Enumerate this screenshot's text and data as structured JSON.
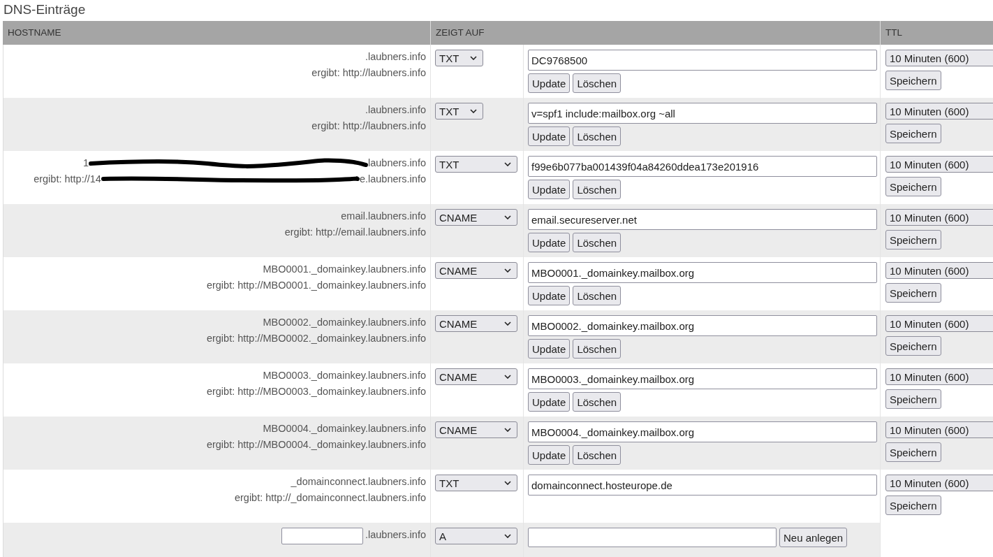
{
  "title": "DNS-Einträge",
  "columns": [
    "HOSTNAME",
    "ZEIGT AUF",
    "TTL"
  ],
  "rows": [
    {
      "kind": "record",
      "hostname": ".laubners.info",
      "result": "ergibt: http://laubners.info",
      "type": "TXT",
      "value": "DC9768500",
      "buttons": [
        "Update",
        "Löschen"
      ],
      "ttl": "10 Minuten (600)",
      "save": "Speichern"
    },
    {
      "kind": "record",
      "hostname": ".laubners.info",
      "result": "ergibt: http://laubners.info",
      "type": "TXT",
      "value": "v=spf1 include:mailbox.org ~all",
      "buttons": [
        "Update",
        "Löschen"
      ],
      "ttl": "10 Minuten (600)",
      "save": "Speichern"
    },
    {
      "kind": "redacted",
      "hostname_start": "1",
      "hostname_end": "laubners.info",
      "result_start": "ergibt: http://14",
      "result_end": "e.laubners.info",
      "type": "TXT",
      "value": "f99e6b077ba001439f04a84260ddea173e201916",
      "buttons": [
        "Update",
        "Löschen"
      ],
      "ttl": "10 Minuten (600)",
      "save": "Speichern"
    },
    {
      "kind": "record",
      "hostname": "email.laubners.info",
      "result": "ergibt: http://email.laubners.info",
      "type": "CNAME",
      "value": "email.secureserver.net",
      "buttons": [
        "Update",
        "Löschen"
      ],
      "ttl": "10 Minuten (600)",
      "save": "Speichern"
    },
    {
      "kind": "record",
      "hostname": "MBO0001._domainkey.laubners.info",
      "result": "ergibt: http://MBO0001._domainkey.laubners.info",
      "type": "CNAME",
      "value": "MBO0001._domainkey.mailbox.org",
      "buttons": [
        "Update",
        "Löschen"
      ],
      "ttl": "10 Minuten (600)",
      "save": "Speichern"
    },
    {
      "kind": "record",
      "hostname": "MBO0002._domainkey.laubners.info",
      "result": "ergibt: http://MBO0002._domainkey.laubners.info",
      "type": "CNAME",
      "value": "MBO0002._domainkey.mailbox.org",
      "buttons": [
        "Update",
        "Löschen"
      ],
      "ttl": "10 Minuten (600)",
      "save": "Speichern"
    },
    {
      "kind": "record",
      "hostname": "MBO0003._domainkey.laubners.info",
      "result": "ergibt: http://MBO0003._domainkey.laubners.info",
      "type": "CNAME",
      "value": "MBO0003._domainkey.mailbox.org",
      "buttons": [
        "Update",
        "Löschen"
      ],
      "ttl": "10 Minuten (600)",
      "save": "Speichern"
    },
    {
      "kind": "record",
      "hostname": "MBO0004._domainkey.laubners.info",
      "result": "ergibt: http://MBO0004._domainkey.laubners.info",
      "type": "CNAME",
      "value": "MBO0004._domainkey.mailbox.org",
      "buttons": [
        "Update",
        "Löschen"
      ],
      "ttl": "10 Minuten (600)",
      "save": "Speichern"
    },
    {
      "kind": "record",
      "hostname": "_domainconnect.laubners.info",
      "result": "ergibt: http://_domainconnect.laubners.info",
      "type": "TXT",
      "value": "domainconnect.hosteurope.de",
      "ttl": "10 Minuten (600)",
      "save": "Speichern"
    },
    {
      "kind": "new",
      "suffix": ".laubners.info",
      "type": "A",
      "button": "Neu anlegen"
    }
  ]
}
